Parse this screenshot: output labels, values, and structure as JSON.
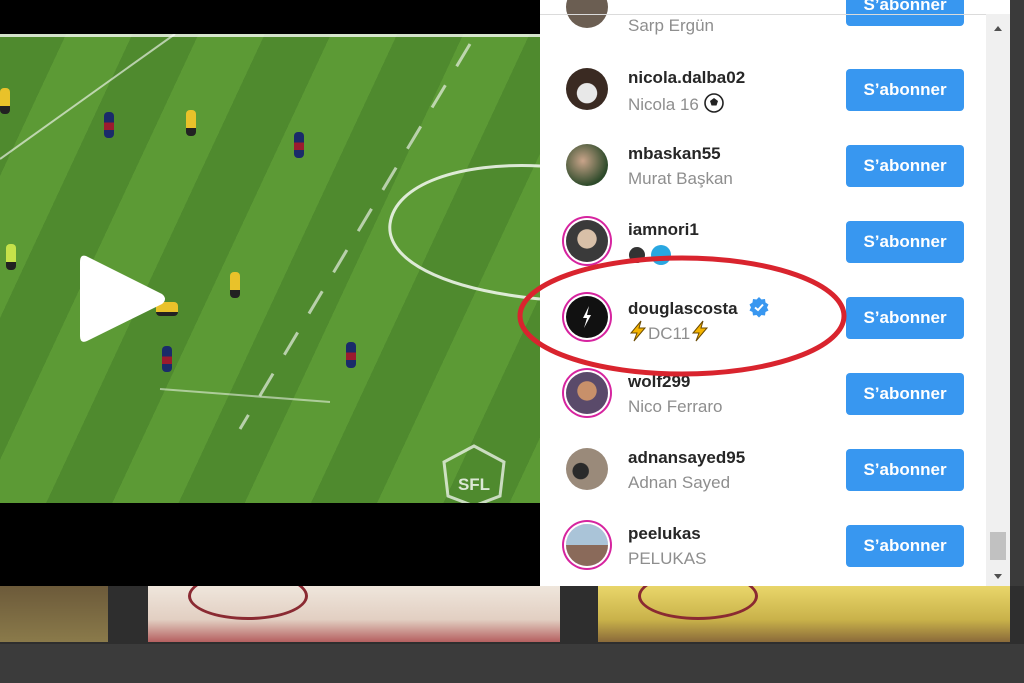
{
  "follow_list": {
    "button_label": "S’abonner",
    "rows": [
      {
        "username": "",
        "fullname": "Sarp Ergün"
      },
      {
        "username": "nicola.dalba02",
        "fullname": "Nicola 16"
      },
      {
        "username": "mbaskan55",
        "fullname": "Murat Başkan"
      },
      {
        "username": "iamnori1",
        "fullname": ""
      },
      {
        "username": "douglascosta",
        "fullname": "DC11"
      },
      {
        "username": "wolf299",
        "fullname": "Nico Ferraro"
      },
      {
        "username": "adnansayed95",
        "fullname": "Adnan Sayed"
      },
      {
        "username": "peelukas",
        "fullname": "PELUKAS"
      }
    ]
  },
  "video": {
    "watermark": "SFL"
  },
  "colors": {
    "button": "#3897f0",
    "annotation": "#d9242e",
    "verified": "#3897f0"
  },
  "icons": [
    "play-icon",
    "verified-badge-icon",
    "soccer-ball-icon",
    "lightning-icon",
    "scroll-up-arrow-icon",
    "scroll-down-arrow-icon"
  ]
}
